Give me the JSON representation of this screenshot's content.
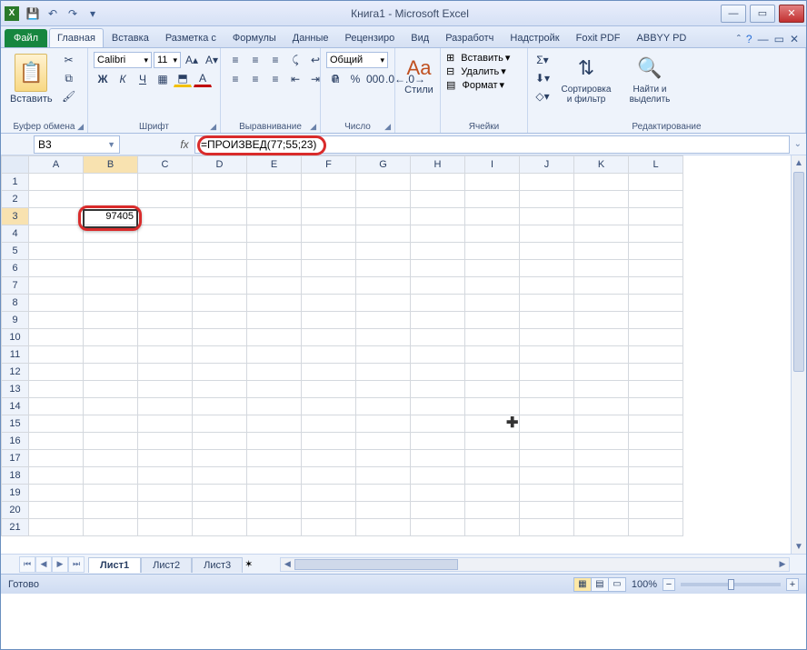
{
  "window": {
    "title": "Книга1 - Microsoft Excel"
  },
  "qat": {
    "save": "💾",
    "undo": "↶",
    "redo": "↷",
    "more": "▾"
  },
  "tabs": {
    "file": "Файл",
    "items": [
      "Главная",
      "Вставка",
      "Разметка с",
      "Формулы",
      "Данные",
      "Рецензиро",
      "Вид",
      "Разработч",
      "Надстройк",
      "Foxit PDF",
      "ABBYY PD"
    ],
    "active_index": 0
  },
  "ribbon": {
    "clipboard": {
      "paste": "Вставить",
      "label": "Буфер обмена"
    },
    "font": {
      "name": "Calibri",
      "size": "11",
      "label": "Шрифт"
    },
    "alignment": {
      "label": "Выравнивание"
    },
    "number": {
      "format": "Общий",
      "label": "Число"
    },
    "styles": {
      "btn": "Стили",
      "label": ""
    },
    "cells": {
      "insert": "Вставить",
      "delete": "Удалить",
      "format": "Формат",
      "label": "Ячейки"
    },
    "editing": {
      "sort": "Сортировка и фильтр",
      "find": "Найти и выделить",
      "label": "Редактирование"
    }
  },
  "namebox": "B3",
  "formula": "=ПРОИЗВЕД(77;55;23)",
  "columns": [
    "A",
    "B",
    "C",
    "D",
    "E",
    "F",
    "G",
    "H",
    "I",
    "J",
    "K",
    "L"
  ],
  "row_count": 21,
  "active": {
    "col_index": 1,
    "row": 3,
    "value": "97405"
  },
  "sheets": {
    "items": [
      "Лист1",
      "Лист2",
      "Лист3"
    ],
    "active_index": 0
  },
  "status": {
    "ready": "Готово",
    "zoom": "100%"
  }
}
